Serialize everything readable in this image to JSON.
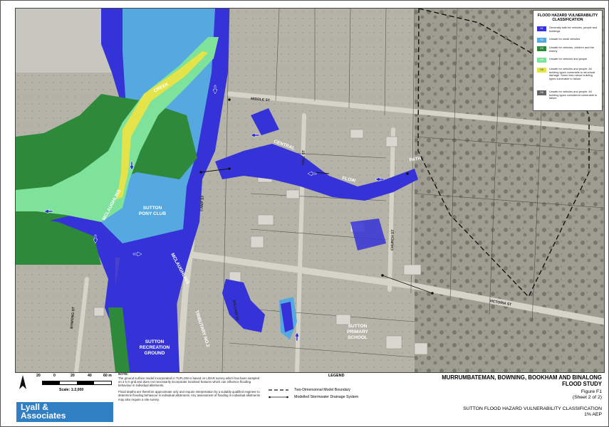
{
  "map": {
    "labels": {
      "creek": "CREEK",
      "central": "CENTRAL",
      "flow": "FLOW",
      "path": "PATH",
      "mclaughlins_top": "MCLAUGHLINS",
      "mclaughlins_bottom": "MCLAUGHLINS",
      "sutton": "SUTTON",
      "pony_club": "PONY CLUB",
      "recreation_sutton": "SUTTON",
      "recreation": "RECREATION",
      "ground": "GROUND",
      "primary_sutton": "SUTTON",
      "primary": "PRIMARY",
      "school": "SCHOOL",
      "middle_st": "MIDDLE ST",
      "camp_st": "CAMP ST",
      "tributary": "TRIBUTARY NO.2",
      "victoria_st": "VICTORIA ST",
      "church_st": "CHURCH ST",
      "hall_st": "HALL ST",
      "william_st": "WILLIAM ST",
      "bywong_st": "BYWONG ST"
    }
  },
  "legend": {
    "title": "FLOOD HAZARD VULNERABILITY CLASSIFICATION",
    "items": [
      {
        "code": "H1",
        "color": "#3533d8",
        "text": "Generally safe for vehicles, people and buildings"
      },
      {
        "code": "H2",
        "color": "#55a9e0",
        "text": "Unsafe for small vehicles"
      },
      {
        "code": "H3",
        "color": "#2e8a3a",
        "text": "Unsafe for vehicles, children and the elderly"
      },
      {
        "code": "H4",
        "color": "#7fe29a",
        "text": "Unsafe for vehicles and people"
      },
      {
        "code": "H5",
        "color": "#e4e44a",
        "text": "Unsafe for vehicles and people. All building types vulnerable to structural damage. Some less robust building types vulnerable to failure"
      },
      {
        "code": "H6",
        "color": "#666666",
        "text": "Unsafe for vehicles and people. All building types considered vulnerable to failure"
      }
    ]
  },
  "scale": {
    "ticks": [
      "20",
      "0",
      "20",
      "40",
      "60 m"
    ],
    "label": "Scale: 1:2,000"
  },
  "note": {
    "heading": "NOTE:",
    "para1": "The ground surface model incorporated in TUFLOW is based on LiDAR survey which has been sampled on a 5 m grid and does not necessarily incorporate localised features which can influence flooding behaviour in individual allotments.",
    "para2": "Flood depths are therefore approximate only and require interpretation by a suitably qualified engineer to determine flooding behaviour in individual allotments. Any assessment of flooding in individual allotments may also require a site survey."
  },
  "logo": {
    "line1": "Lyall &",
    "line2": "Associates"
  },
  "legend2": {
    "heading": "LEGEND",
    "boundary": "Two-Dimensional Model Boundary",
    "drainage": "Modelled Stormwater Drainage System"
  },
  "titleblock": {
    "title1": "MURRUMBATEMAN, BOWNING, BOOKHAM AND BINALONG",
    "title2": "FLOOD STUDY",
    "figure": "Figure F1",
    "sheet": "(Sheet 2 of 2)",
    "subtitle": "SUTTON FLOOD HAZARD VULNERABILITY CLASSIFICATION",
    "aep": "1% AEP"
  }
}
